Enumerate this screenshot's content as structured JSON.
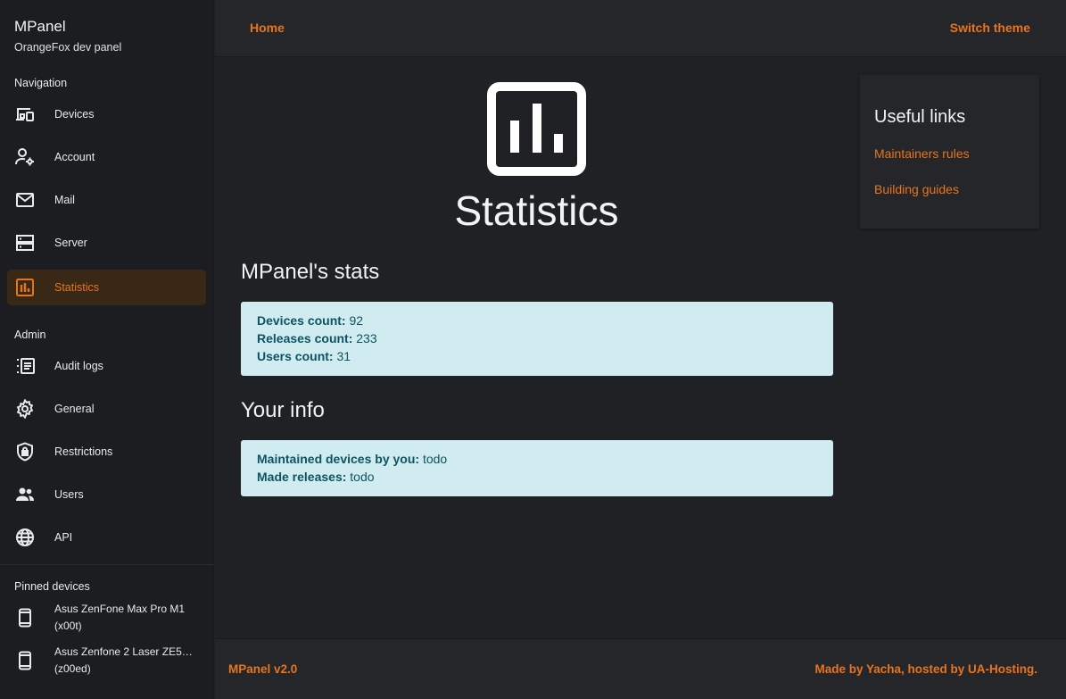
{
  "brand": {
    "title": "MPanel",
    "subtitle": "OrangeFox dev panel"
  },
  "sidebar": {
    "navigation_label": "Navigation",
    "navigation": [
      {
        "label": "Devices",
        "icon": "devices-icon"
      },
      {
        "label": "Account",
        "icon": "account-settings-icon"
      },
      {
        "label": "Mail",
        "icon": "mail-icon"
      },
      {
        "label": "Server",
        "icon": "server-icon"
      },
      {
        "label": "Statistics",
        "icon": "statistics-icon",
        "active": true
      }
    ],
    "admin_label": "Admin",
    "admin": [
      {
        "label": "Audit logs",
        "icon": "audit-logs-icon"
      },
      {
        "label": "General",
        "icon": "gear-icon"
      },
      {
        "label": "Restrictions",
        "icon": "shield-lock-icon"
      },
      {
        "label": "Users",
        "icon": "users-icon"
      },
      {
        "label": "API",
        "icon": "globe-icon"
      }
    ],
    "pinned_label": "Pinned devices",
    "pinned": [
      {
        "name": "Asus ZenFone Max Pro M1",
        "code": "(x00t)",
        "icon": "phone-icon"
      },
      {
        "name": "Asus Zenfone 2 Laser ZE5…",
        "code": "(z00ed)",
        "icon": "phone-icon"
      }
    ]
  },
  "topbar": {
    "home": "Home",
    "switch_theme": "Switch theme"
  },
  "main": {
    "page_title": "Statistics",
    "stats_heading": "MPanel's stats",
    "stats": {
      "devices_label": "Devices count:",
      "devices_value": "92",
      "releases_label": "Releases count:",
      "releases_value": "233",
      "users_label": "Users count:",
      "users_value": "31"
    },
    "info_heading": "Your info",
    "info": {
      "maintained_label": "Maintained devices by you:",
      "maintained_value": "todo",
      "releases_label": "Made releases:",
      "releases_value": "todo"
    }
  },
  "useful_links": {
    "title": "Useful links",
    "items": [
      "Maintainers rules",
      "Building guides"
    ]
  },
  "footer": {
    "left": "MPanel v2.0",
    "right": "Made by Yacha, hosted by UA-Hosting."
  },
  "colors": {
    "accent": "#e8741f",
    "background": "#202124",
    "sidebar": "#1c1d20",
    "alert_bg": "#d1ecf1",
    "alert_text": "#0c5460"
  }
}
